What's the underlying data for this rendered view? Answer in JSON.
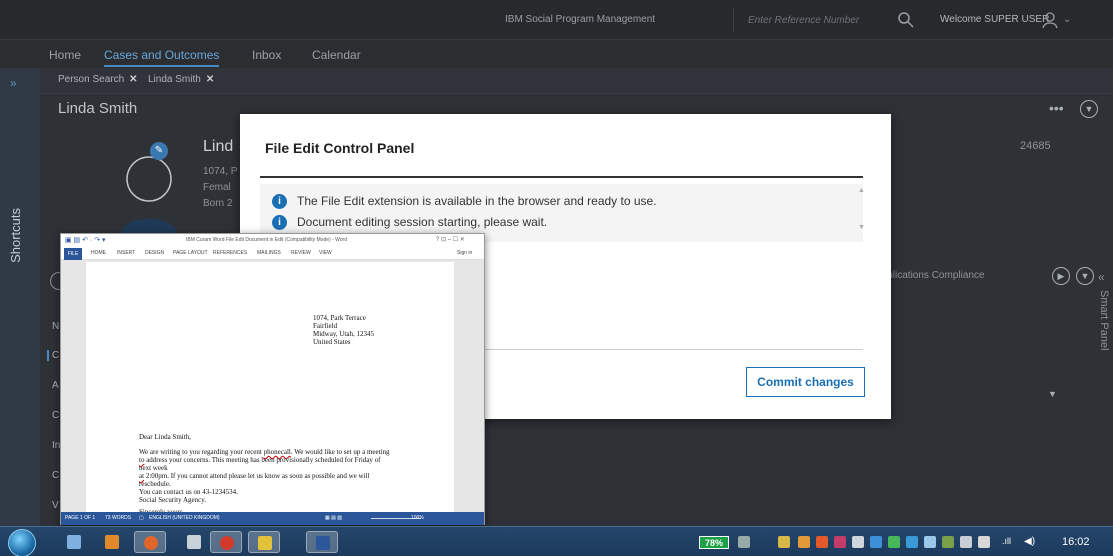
{
  "topbar": {
    "product": "IBM Social Program Management",
    "reference_placeholder": "Enter Reference Number",
    "welcome": "Welcome SUPER USER"
  },
  "mainnav": {
    "items": [
      "Home",
      "Cases and Outcomes",
      "Inbox",
      "Calendar"
    ]
  },
  "sidebar": {
    "label": "Shortcuts",
    "expand": "»"
  },
  "tabs": [
    {
      "label": "Person Search"
    },
    {
      "label": "Linda Smith"
    }
  ],
  "page": {
    "title": "Linda Smith",
    "person_name": "Lind",
    "address": "1074, P",
    "gender": "Femal",
    "born": "Born 2",
    "reference": "24685",
    "more": "•••",
    "content_tabs": "Applications    Compliance",
    "smart_panel": "Smart Panel",
    "side_items": [
      "N",
      "C",
      "A",
      "C",
      "In",
      "C",
      "V"
    ]
  },
  "modal": {
    "title": "File Edit Control Panel",
    "messages": [
      "The File Edit extension is available in the browser and ready to use.",
      "Document editing session starting, please wait."
    ],
    "commit_label": "Commit changes"
  },
  "word": {
    "title": "IBM Curam Word File Edit Document in Edit (Compatibility Mode) - Word",
    "window_controls": "?  ⊡  –  ☐  ✕",
    "sign_in": "Sign in",
    "ribbon_tabs": [
      "HOME",
      "INSERT",
      "DESIGN",
      "PAGE LAYOUT",
      "REFERENCES",
      "MAILINGS",
      "REVIEW",
      "VIEW"
    ],
    "file_tab": "FILE",
    "address_lines": [
      "1074, Park Terrace",
      "Fairfield",
      "Midway, Utah, 12345",
      "United States"
    ],
    "salutation": "Dear Linda Smith,",
    "body1": "We are writing to you regarding your recent",
    "body1_err": "phonecall",
    "body1b": ". We would like to set up a meeting",
    "body2_err": "to",
    "body2": " address your concerns. This meeting has been provisionally scheduled for Friday of",
    "body3": "next week",
    "body4_err": "at",
    "body4": " 2:00pm. If you cannot attend please let us know as soon as possible and we will",
    "body5": "reschedule.",
    "body6": "You can contact us on 43-1234534.",
    "closing": "Sincerely yours,",
    "signature": "Social Security Agency.",
    "status": {
      "page": "PAGE 1 OF 1",
      "words": "73 WORDS",
      "language": "ENGLISH (UNITED KINGDOM)",
      "zoom": "100%"
    }
  },
  "taskbar": {
    "battery": "78%",
    "time": "16:02"
  },
  "colors": {
    "accent": "#1a6fb5",
    "word_blue": "#2b579a",
    "dark_bg": "#2b2d31"
  }
}
